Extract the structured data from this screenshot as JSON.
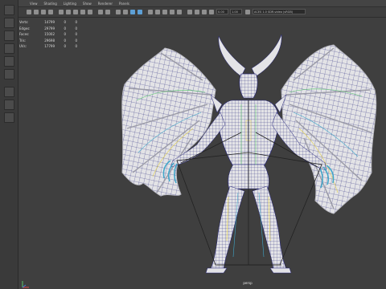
{
  "app": {
    "menu": [
      "View",
      "Shading",
      "Lighting",
      "Show",
      "Renderer",
      "Panels"
    ]
  },
  "toolbar": {
    "near_clip": "0.00",
    "far_clip": "1.00",
    "colorspace": "ACES 1.0 SDR-video (sRGB)"
  },
  "hud": {
    "rows": [
      {
        "label": "Verts:",
        "c1": "14799",
        "c2": "0",
        "c3": "0"
      },
      {
        "label": "Edges:",
        "c1": "29799",
        "c2": "0",
        "c3": "0"
      },
      {
        "label": "Faces:",
        "c1": "15002",
        "c2": "0",
        "c3": "0"
      },
      {
        "label": "Tris:",
        "c1": "29698",
        "c2": "0",
        "c3": "0"
      },
      {
        "label": "UVs:",
        "c1": "17799",
        "c2": "0",
        "c3": "0"
      }
    ]
  },
  "viewport": {
    "camera": "persp",
    "colors": {
      "background": "#3f3f3f",
      "mesh_fill": "#e3e3e6",
      "wireframe": "#23237a",
      "skeleton": "#222222",
      "joint_green": "#57c76a",
      "joint_yellow": "#e4d24c",
      "joint_blue": "#3fa6c9"
    }
  }
}
